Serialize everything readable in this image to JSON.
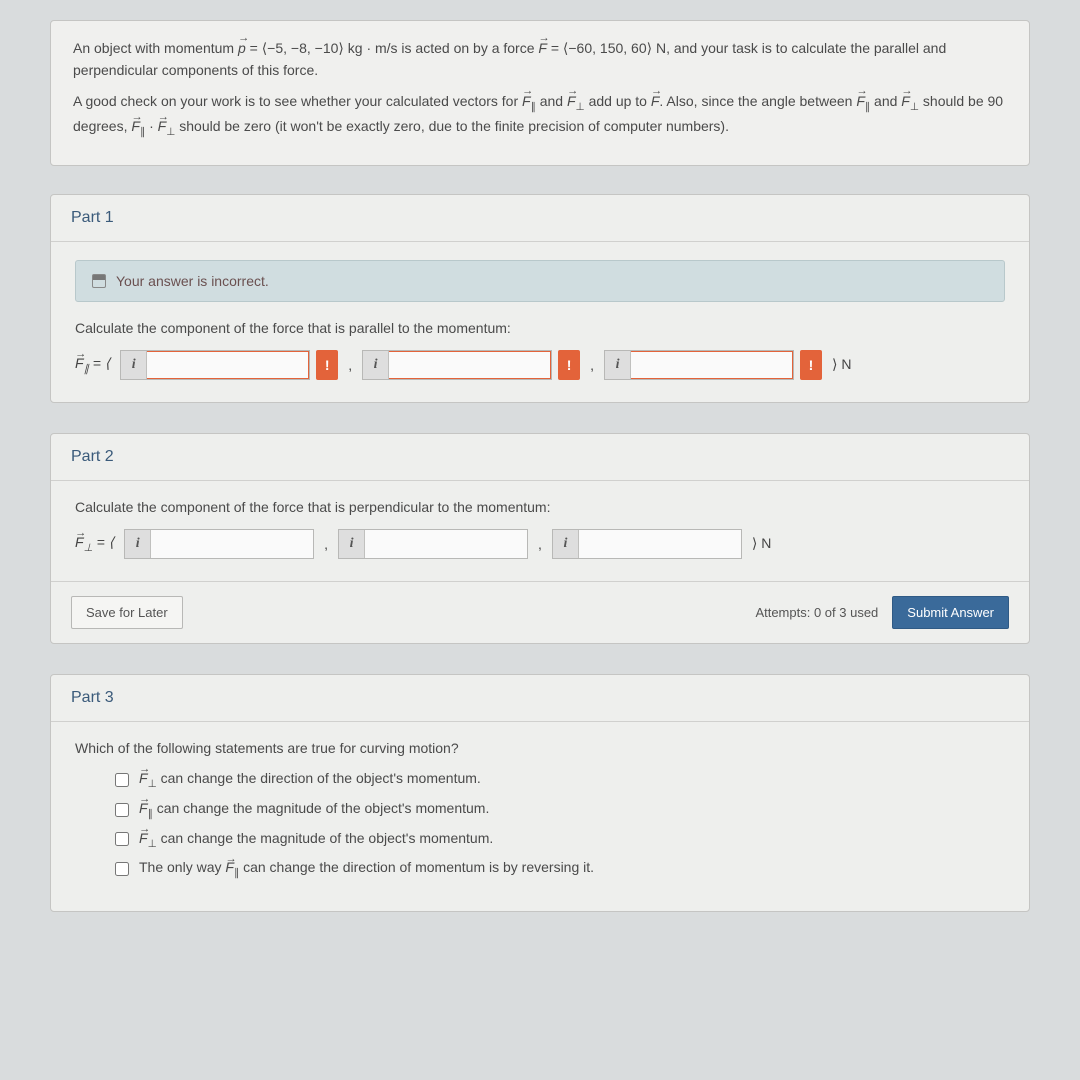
{
  "question": {
    "p1a": "An object with momentum ",
    "p_vec": "p",
    "p1b": " = ⟨−5, −8, −10⟩ kg · m/s is acted on by a force ",
    "F_vec": "F",
    "p1c": " = ⟨−60, 150, 60⟩ N, and your task is to calculate the parallel and perpendicular components of this force.",
    "p2a": "A good check on your work is to see whether your calculated vectors for ",
    "p2b": " and ",
    "p2c": " add up to ",
    "p2d": ". Also, since the angle between ",
    "p2e": " should be 90 degrees, ",
    "p2f": " · ",
    "p2g": " should be zero (it won't be exactly zero, due to the finite precision of computer numbers)."
  },
  "part1": {
    "title": "Part 1",
    "feedback": "Your answer is incorrect.",
    "prompt": "Calculate the component of the force that is parallel to the momentum:",
    "label_open": " = ⟨",
    "sep": ",",
    "close": "⟩ N"
  },
  "part2": {
    "title": "Part 2",
    "prompt": "Calculate the component of the force that is perpendicular to the momentum:",
    "label_open": " = ⟨",
    "sep": ",",
    "close": "⟩ N",
    "save": "Save for Later",
    "attempts": "Attempts: 0 of 3 used",
    "submit": "Submit Answer"
  },
  "part3": {
    "title": "Part 3",
    "prompt": "Which of the following statements are true for curving motion?",
    "c1a": " can change the direction of the object's momentum.",
    "c2a": " can change the magnitude of the object's momentum.",
    "c3a": " can change the magnitude of the object's momentum.",
    "c4a": "The only way ",
    "c4b": " can change the direction of momentum is by reversing it."
  },
  "glyph": {
    "info": "i",
    "bang": "!"
  }
}
